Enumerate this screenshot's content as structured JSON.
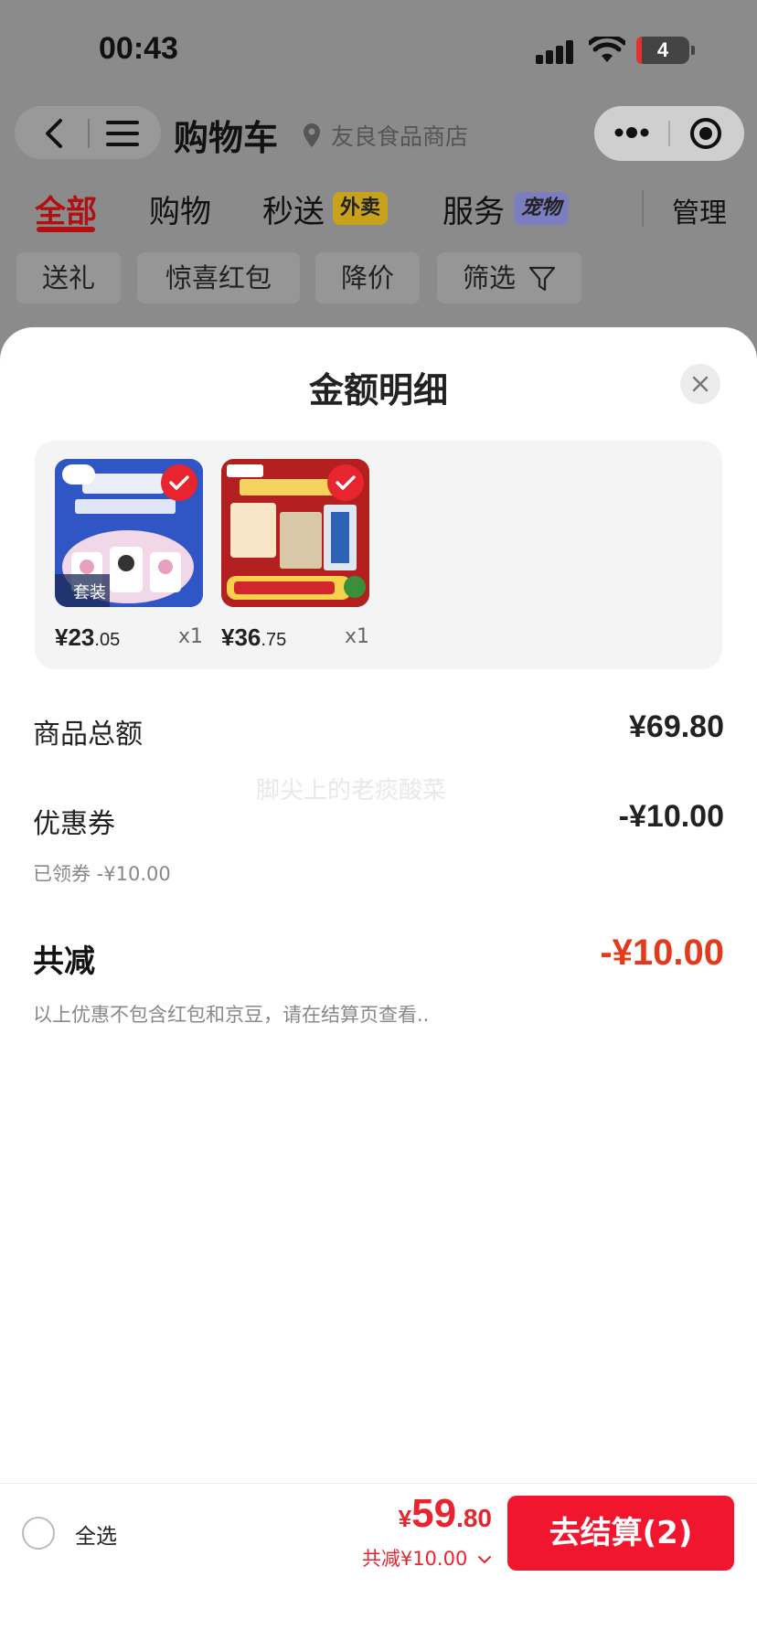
{
  "status_bar": {
    "time": "00:43",
    "battery": "4"
  },
  "nav": {
    "title": "购物车",
    "store": "友良食品商店"
  },
  "tabs": [
    {
      "label": "全部",
      "active": true
    },
    {
      "label": "购物"
    },
    {
      "label": "秒送",
      "badge": "外卖"
    },
    {
      "label": "服务",
      "badge": "宠物"
    }
  ],
  "manage_label": "管理",
  "filters": [
    "送礼",
    "惊喜红包",
    "降价",
    "筛选"
  ],
  "sheet": {
    "title": "金额明细",
    "products": [
      {
        "thumb_caption": "套装",
        "price_int": "¥23",
        "price_dec": ".05",
        "qty": "x1"
      },
      {
        "thumb_caption": "",
        "price_int": "¥36",
        "price_dec": ".75",
        "qty": "x1"
      }
    ],
    "goods_total_label": "商品总额",
    "goods_total_value": "¥69.80",
    "coupon_label": "优惠券",
    "coupon_value": "-¥10.00",
    "coupon_note": "已领券 -¥10.00",
    "total_discount_label": "共减",
    "total_discount_value": "-¥10.00",
    "disclaimer": "以上优惠不包含红包和京豆，请在结算页查看..",
    "watermark": "脚尖上的老痰酸菜"
  },
  "bottom_bar": {
    "select_all": "全选",
    "pay_currency": "¥",
    "pay_int": "59",
    "pay_dec": ".80",
    "discount_line": "共减¥10.00",
    "checkout_label": "去结算(2)"
  },
  "colors": {
    "accent_red": "#e8242e",
    "discount_red": "#e23a1a",
    "tab_active": "#b01010"
  }
}
